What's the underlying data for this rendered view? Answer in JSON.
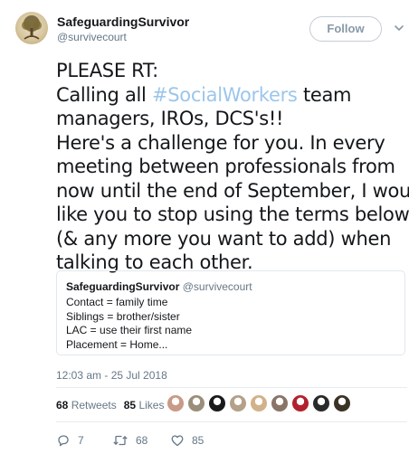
{
  "author": {
    "display_name": "SafeguardingSurvivor",
    "screen_name": "@survivecourt"
  },
  "follow_label": "Follow",
  "tweet": {
    "lines": [
      {
        "parts": [
          {
            "text": "PLEASE RT:",
            "hashtag": false
          }
        ]
      },
      {
        "parts": [
          {
            "text": "Calling all ",
            "hashtag": false
          },
          {
            "text": "#SocialWorkers",
            "hashtag": true
          },
          {
            "text": " team",
            "hashtag": false
          }
        ]
      },
      {
        "parts": [
          {
            "text": "managers, IROs, DCS's!!",
            "hashtag": false
          }
        ]
      },
      {
        "parts": [
          {
            "text": "Here's a challenge for you. In every",
            "hashtag": false
          }
        ]
      },
      {
        "parts": [
          {
            "text": "meeting between professionals from",
            "hashtag": false
          }
        ]
      },
      {
        "parts": [
          {
            "text": "now until the end of September, I would",
            "hashtag": false
          }
        ]
      },
      {
        "parts": [
          {
            "text": "like you to stop using the terms below",
            "hashtag": false
          }
        ]
      },
      {
        "parts": [
          {
            "text": "(& any more you want to add) when",
            "hashtag": false
          }
        ]
      },
      {
        "parts": [
          {
            "text": "talking to each other.",
            "hashtag": false
          }
        ]
      }
    ]
  },
  "quote": {
    "display_name": "SafeguardingSurvivor",
    "screen_name": "@survivecourt",
    "lines": [
      "Contact = family time",
      "Siblings = brother/sister",
      "LAC = use their first name",
      "Placement = Home..."
    ]
  },
  "timestamp": "12:03 am - 25 Jul 2018",
  "stats": {
    "retweets_count": "68",
    "retweets_label": "Retweets",
    "likes_count": "85",
    "likes_label": "Likes"
  },
  "liker_avatars": [
    {
      "icon": "user-avatar",
      "color": "#c99a86"
    },
    {
      "icon": "user-avatar",
      "color": "#9a8f7a"
    },
    {
      "icon": "user-avatar",
      "color": "#1a1a1a"
    },
    {
      "icon": "user-avatar",
      "color": "#b5a089"
    },
    {
      "icon": "user-avatar",
      "color": "#d2b28a"
    },
    {
      "icon": "user-avatar",
      "color": "#8a7468"
    },
    {
      "icon": "user-avatar",
      "color": "#b2222c"
    },
    {
      "icon": "user-avatar",
      "color": "#2a2a2a"
    },
    {
      "icon": "user-avatar",
      "color": "#3b3226"
    }
  ],
  "actions": {
    "reply_count": "7",
    "retweet_count": "68",
    "like_count": "85"
  },
  "colors": {
    "hashtag": "#9cc6ea",
    "secondary_text": "#657786",
    "follow_border": "#c4ccd3"
  }
}
